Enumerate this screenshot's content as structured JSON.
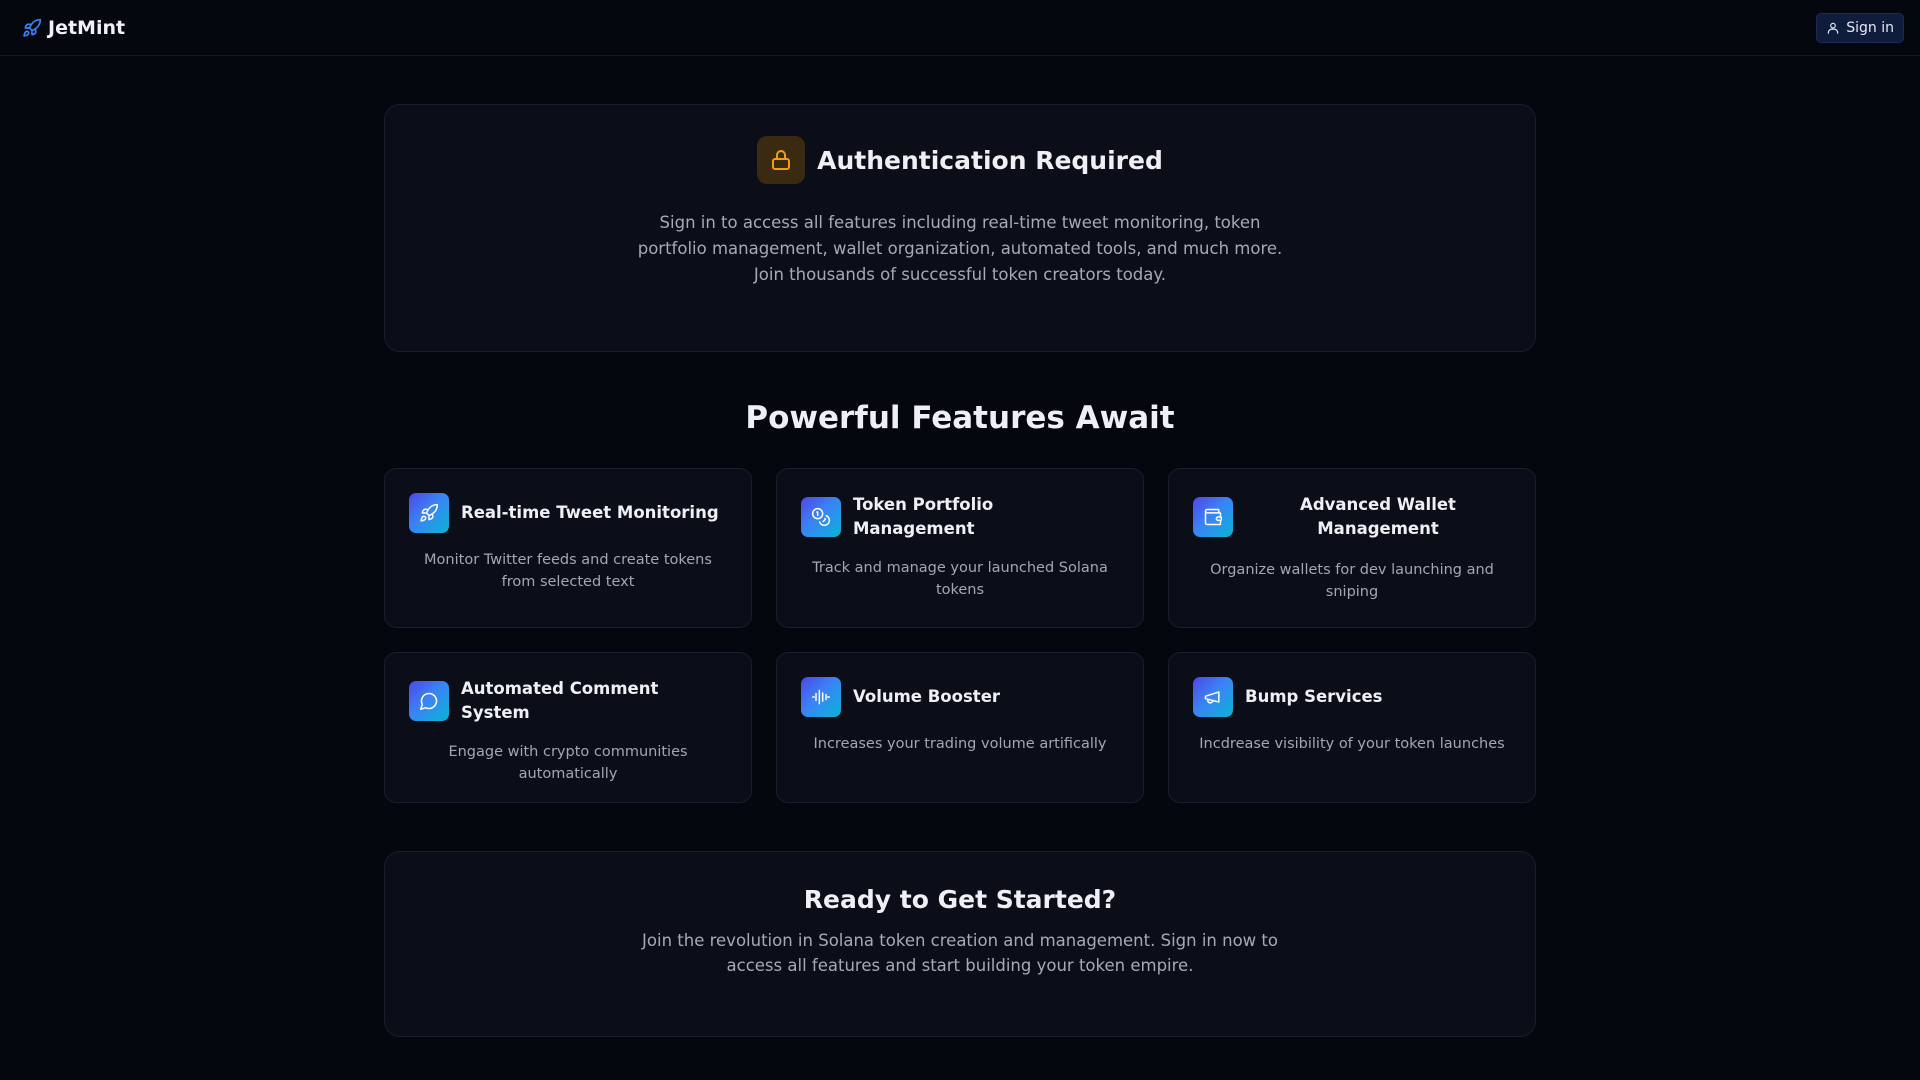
{
  "header": {
    "brand": "JetMint",
    "sign_in_label": "Sign in",
    "brand_icon": "rocket-icon",
    "sign_in_icon": "user-icon"
  },
  "auth": {
    "title": "Authentication Required",
    "description": "Sign in to access all features including real-time tweet monitoring, token portfolio management, wallet organization, automated tools, and much more. Join thousands of successful token creators today.",
    "icon": "lock-icon"
  },
  "features": {
    "title": "Powerful Features Await",
    "items": [
      {
        "title": "Real-time Tweet Monitoring",
        "description": "Monitor Twitter feeds and create tokens from selected text",
        "icon": "rocket-icon"
      },
      {
        "title": "Token Portfolio Management",
        "description": "Track and manage your launched Solana tokens",
        "icon": "coins-icon"
      },
      {
        "title": "Advanced Wallet Management",
        "description": "Organize wallets for dev launching and sniping",
        "icon": "wallet-icon"
      },
      {
        "title": "Automated Comment System",
        "description": "Engage with crypto communities automatically",
        "icon": "message-circle-icon"
      },
      {
        "title": "Volume Booster",
        "description": "Increases your trading volume artifically",
        "icon": "audio-waveform-icon"
      },
      {
        "title": "Bump Services",
        "description": "Incdrease visibility of your token launches",
        "icon": "megaphone-icon"
      }
    ]
  },
  "cta": {
    "title": "Ready to Get Started?",
    "description": "Join the revolution in Solana token creation and management. Sign in now to access all features and start building your token empire."
  },
  "colors": {
    "background": "#05070f",
    "card": "#0b0e18",
    "brand_accent": "#3b82f6",
    "lock_accent": "#f59e0b",
    "gradient_start": "#4f46e5",
    "gradient_end": "#06b6d4"
  }
}
